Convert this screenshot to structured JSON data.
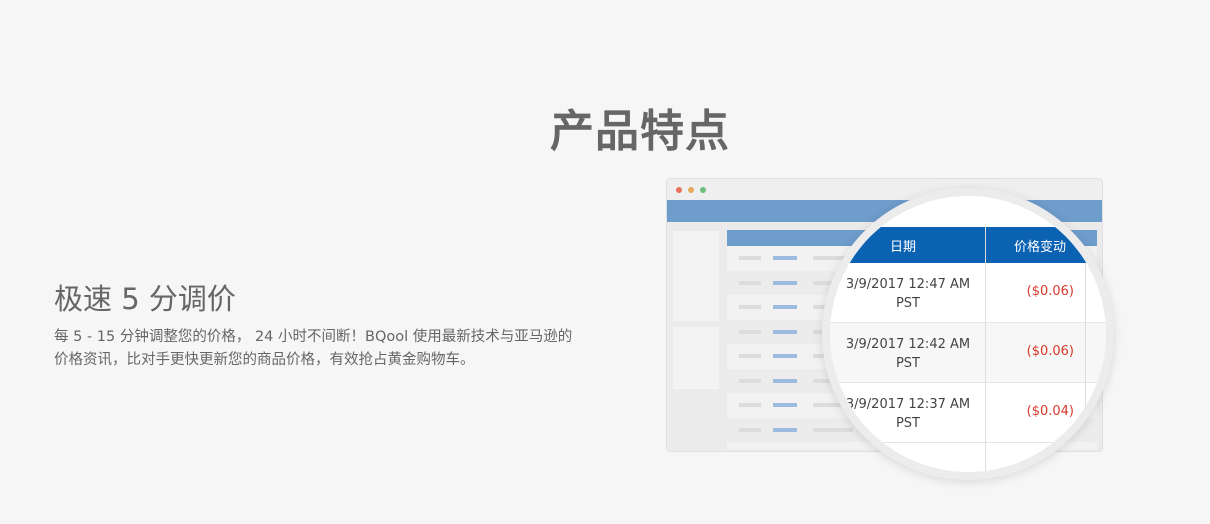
{
  "section": {
    "title": "产品特点"
  },
  "feature": {
    "title": "极速 5 分调价",
    "description": "每 5 - 15 分钟调整您的价格， 24 小时不间断！BQool 使用最新技术与亚马逊的价格资讯，比对手更快更新您的商品价格，有效抢占黄金购物车。"
  },
  "illustration": {
    "columns": {
      "date": "日期",
      "price_change": "价格变动"
    },
    "rows": [
      {
        "time": "3/9/2017 12:47 AM PST",
        "change": "($0.06)"
      },
      {
        "time": "3/9/2017 12:42 AM PST",
        "change": "($0.06)"
      },
      {
        "time": "3/9/2017 12:37 AM PST",
        "change": "($0.04)"
      }
    ],
    "colors": {
      "header_blue": "#0b62b3",
      "negative_red": "#d9382b",
      "mock_nav_blue": "#6e9ccb"
    }
  }
}
